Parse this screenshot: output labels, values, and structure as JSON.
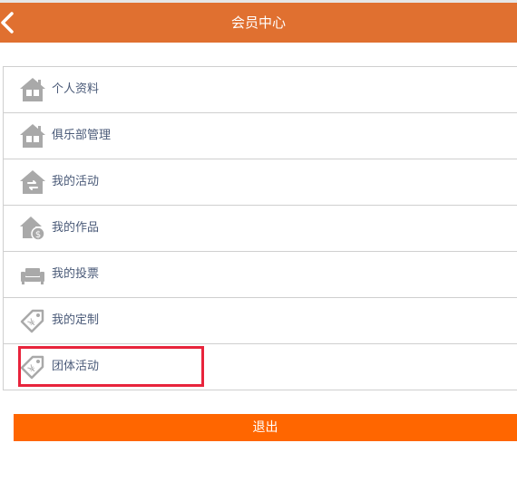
{
  "header": {
    "title": "会员中心",
    "back_icon": "chevron-left-icon",
    "background": "#e07030"
  },
  "menu": {
    "items": [
      {
        "label": "个人资料",
        "icon": "house-icon"
      },
      {
        "label": "俱乐部管理",
        "icon": "house-icon"
      },
      {
        "label": "我的活动",
        "icon": "house-exchange-icon"
      },
      {
        "label": "我的作品",
        "icon": "house-money-icon"
      },
      {
        "label": "我的投票",
        "icon": "sofa-icon"
      },
      {
        "label": "我的定制",
        "icon": "price-tag-icon"
      },
      {
        "label": "团体活动",
        "icon": "price-tag-icon"
      }
    ]
  },
  "logout": {
    "label": "退出",
    "background": "#ff6600"
  },
  "colors": {
    "highlight": "#e8243c",
    "icon_gray": "#a9a9a9",
    "label_text": "#4a5a78"
  }
}
